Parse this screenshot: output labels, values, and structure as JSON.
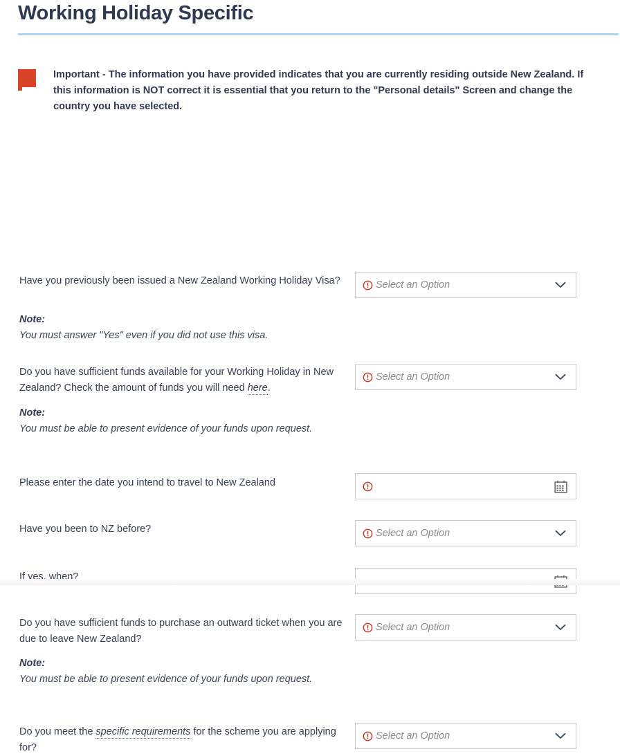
{
  "page": {
    "title": "Working Holiday Specific"
  },
  "notice": {
    "marker_color": "#d9432a",
    "icon": "red-flag-marker",
    "part1": "Important - The information you have provided indicates that you are currently residing outside ",
    "emphasis": "New Zealand",
    "part2": ". If this information is NOT correct it is essential that you return to the \"Personal details\" Screen and change the country you have selected."
  },
  "theme": {
    "accent_rule": "#aed3ea",
    "title_color": "#2f3a52",
    "text_color": "#333f52",
    "warning_color": "#cc3118",
    "placeholder_color": "#8c8c8c",
    "border_color": "#c8c8c8"
  },
  "questions": [
    {
      "id": "previous-whv",
      "label": "Have you previously been issued a New Zealand Working Holiday Visa?",
      "control": "select",
      "placeholder": "Select an Option",
      "required": true,
      "note_head": "Note:",
      "note_body": "You must answer \"Yes\" even if you did not use this visa."
    },
    {
      "id": "sufficient-funds",
      "label_part1": "Do you have sufficient funds available for your Working Holiday in New Zealand? Check the amount of funds you will need ",
      "link_text": "here",
      "label_part2": ".",
      "control": "select",
      "placeholder": "Select an Option",
      "required": true,
      "note_head": "Note:",
      "note_body": "You must be able to present evidence of your funds upon request."
    },
    {
      "id": "intended-travel-date",
      "label": "Please enter the date you intend to travel to New Zealand",
      "control": "date",
      "placeholder": "",
      "required": true
    },
    {
      "id": "been-to-nz",
      "label": "Have you been to NZ before?",
      "control": "select",
      "placeholder": "Select an Option",
      "required": true
    },
    {
      "id": "if-yes-when",
      "label": "If yes, when?",
      "control": "date",
      "placeholder": "",
      "required": false
    },
    {
      "id": "outward-ticket-funds",
      "label": "Do you have sufficient funds to purchase an outward ticket when you are due to leave New Zealand?",
      "control": "select",
      "placeholder": "Select an Option",
      "required": true,
      "note_head": "Note:",
      "note_body": "You must be able to present evidence of your funds upon request."
    },
    {
      "id": "specific-requirements",
      "label_part1": "Do you meet the ",
      "link_text": "specific requirements",
      "label_part2": " for the scheme you are applying for?",
      "control": "select",
      "placeholder": "Select an Option",
      "required": true
    }
  ]
}
